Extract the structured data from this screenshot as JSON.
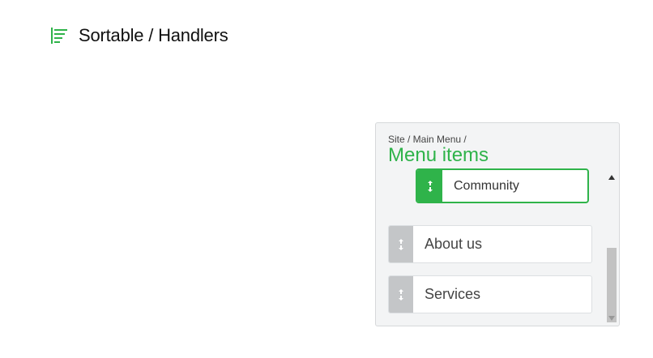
{
  "header": {
    "title": "Sortable / Handlers",
    "logo_icon": "sort-list-icon"
  },
  "panel": {
    "breadcrumb": "Site / Main Menu /",
    "title": "Menu items",
    "items": [
      {
        "label": "Community",
        "state": "dragging"
      },
      {
        "label": "About us"
      },
      {
        "label": "Services"
      }
    ],
    "handle_icon": "drag-handle-icon"
  },
  "colors": {
    "accent": "#2fb34a",
    "handle_idle": "#c4c6c8",
    "panel_bg": "#f3f4f5"
  }
}
